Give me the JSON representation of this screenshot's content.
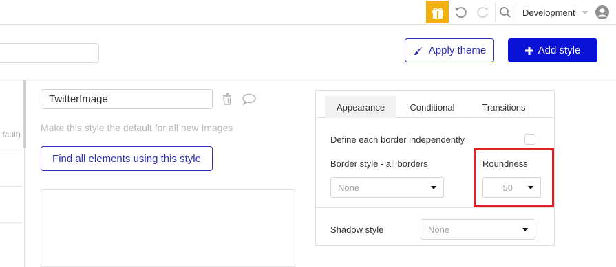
{
  "topbar": {
    "gift_icon": "gift-icon",
    "undo_icon": "undo-icon",
    "redo_icon": "redo-icon",
    "search_icon": "search-icon",
    "environment": "Development",
    "account_icon": "user-account-icon"
  },
  "toolbar": {
    "apply_theme_label": "Apply theme",
    "add_style_label": "Add style",
    "accent_color": "#0a12d8"
  },
  "left_list": {
    "partial_item_text": "fault)"
  },
  "style_editor": {
    "style_name": "TwitterImage",
    "default_text": "Make this style the default for all new Images",
    "find_elements_label": "Find all elements using this style"
  },
  "panel": {
    "tabs": [
      {
        "label": "Appearance",
        "active": true
      },
      {
        "label": "Conditional",
        "active": false
      },
      {
        "label": "Transitions",
        "active": false
      }
    ],
    "define_borders_label": "Define each border independently",
    "define_borders_checked": false,
    "border_style_label": "Border style - all borders",
    "border_style_value": "None",
    "roundness_label": "Roundness",
    "roundness_value": "50",
    "shadow_style_label": "Shadow style",
    "shadow_style_value": "None",
    "highlight_color": "#e02027"
  }
}
